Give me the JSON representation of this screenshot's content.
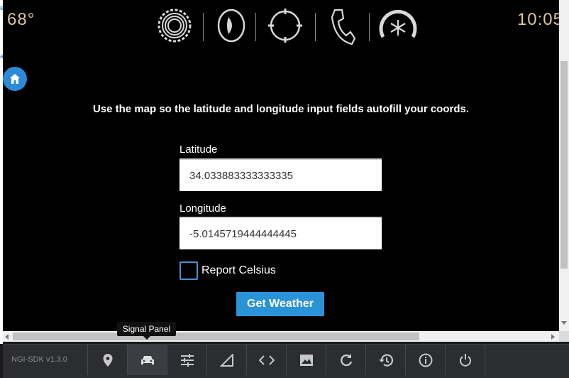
{
  "status": {
    "temperature": "68°",
    "clock": "10:05",
    "icons": [
      "settings-gear-icon",
      "audio-media-icon",
      "navigation-icon",
      "phone-icon",
      "climate-fan-icon"
    ]
  },
  "form": {
    "instruction": "Use the map so the latitude and longitude input fields autofill your coords.",
    "latitude_label": "Latitude",
    "latitude_value": "34.033883333333335",
    "longitude_label": "Longitude",
    "longitude_value": "-5.0145719444444445",
    "celsius_label": "Report Celsius",
    "celsius_checked": false,
    "submit_label": "Get Weather"
  },
  "tooltip": "Signal Panel",
  "toolbar": {
    "sdk_version": "NGI-SDK v1.3.0",
    "buttons": [
      "location-pin-icon",
      "car-icon",
      "sliders-icon",
      "signal-triangle-icon",
      "code-icon",
      "image-icon",
      "refresh-icon",
      "history-icon",
      "info-icon",
      "power-icon"
    ],
    "active_button": "car-icon"
  },
  "colors": {
    "accent_text": "#dcc79a",
    "button_blue": "#2a92d6",
    "toolbar_bg": "#2b2d30"
  }
}
